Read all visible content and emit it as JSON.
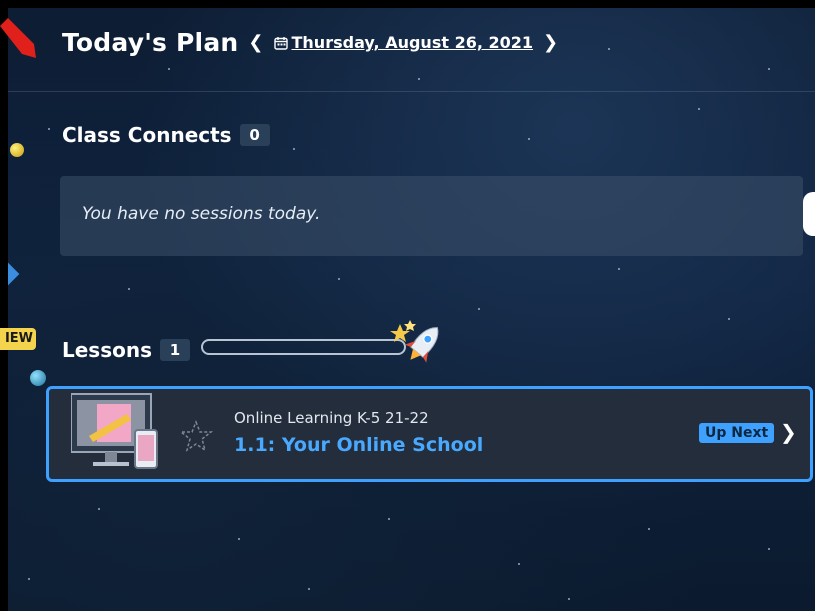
{
  "header": {
    "title": "Today's Plan",
    "prev_icon": "chevron-left-icon",
    "next_icon": "chevron-right-icon",
    "date_icon": "calendar-icon",
    "date": "Thursday, August 26, 2021"
  },
  "class_connects": {
    "heading": "Class Connects",
    "count": "0",
    "empty_message": "You have no sessions today."
  },
  "side_badge": {
    "label": "NEW",
    "visible_text": "IEW"
  },
  "lessons": {
    "heading": "Lessons",
    "count": "1",
    "progress_fraction": 0.0,
    "items": [
      {
        "course": "Online Learning K-5 21-22",
        "title": "1.1: Your Online School",
        "status": "Up Next"
      }
    ]
  },
  "colors": {
    "accent": "#3ea1ff",
    "badge_new": "#f4d44d",
    "pointer_arrow": "#e0201b",
    "card_bg": "#232d3b"
  }
}
